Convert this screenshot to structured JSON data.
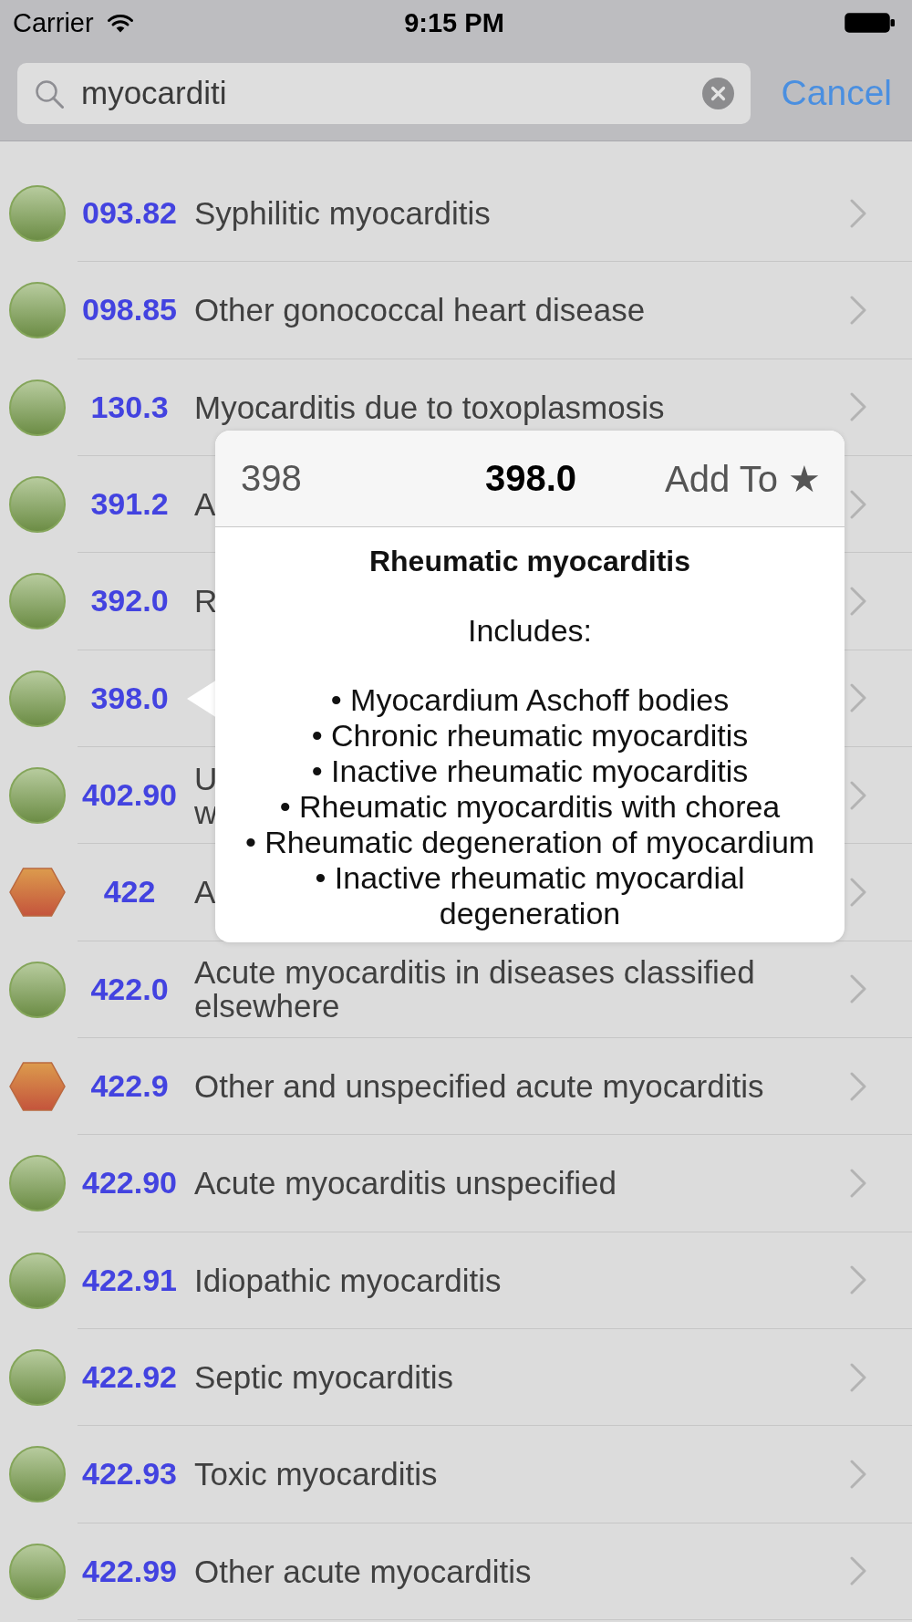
{
  "status_bar": {
    "carrier": "Carrier",
    "time": "9:15 PM"
  },
  "search": {
    "value": "myocarditi",
    "cancel": "Cancel"
  },
  "results": [
    {
      "code": "093.82",
      "kind": "circle",
      "selected": false,
      "lines": [
        "Syphilitic myocarditis"
      ]
    },
    {
      "code": "098.85",
      "kind": "circle",
      "selected": false,
      "lines": [
        "Other gonococcal heart disease"
      ]
    },
    {
      "code": "130.3",
      "kind": "circle",
      "selected": false,
      "lines": [
        "Myocarditis due to toxoplasmosis"
      ]
    },
    {
      "code": "391.2",
      "kind": "circle",
      "selected": false,
      "lines": [
        "A"
      ]
    },
    {
      "code": "392.0",
      "kind": "circle",
      "selected": false,
      "lines": [
        "R"
      ]
    },
    {
      "code": "398.0",
      "kind": "circle",
      "selected": true
    },
    {
      "code": "402.90",
      "kind": "circle",
      "selected": false,
      "lines": [
        "U",
        "w"
      ]
    },
    {
      "code": "422",
      "kind": "hexagon",
      "selected": false,
      "lines": [
        "A"
      ]
    },
    {
      "code": "422.0",
      "kind": "circle",
      "selected": false,
      "lines": [
        "Acute myocarditis in diseases classified",
        "elsewhere"
      ]
    },
    {
      "code": "422.9",
      "kind": "hexagon",
      "selected": false,
      "lines": [
        "Other and unspecified acute myocarditis"
      ]
    },
    {
      "code": "422.90",
      "kind": "circle",
      "selected": false,
      "lines": [
        "Acute myocarditis unspecified"
      ]
    },
    {
      "code": "422.91",
      "kind": "circle",
      "selected": false,
      "lines": [
        "Idiopathic myocarditis"
      ]
    },
    {
      "code": "422.92",
      "kind": "circle",
      "selected": false,
      "lines": [
        "Septic myocarditis"
      ]
    },
    {
      "code": "422.93",
      "kind": "circle",
      "selected": false,
      "lines": [
        "Toxic myocarditis"
      ]
    },
    {
      "code": "422.99",
      "kind": "circle",
      "selected": false,
      "lines": [
        "Other acute myocarditis"
      ]
    }
  ],
  "popover": {
    "parent_code": "398",
    "code": "398.0",
    "action": "Add To ★",
    "heading": "Rheumatic myocarditis",
    "includes_label": "Includes:",
    "items": [
      "• Myocardium Aschoff bodies",
      "• Chronic rheumatic myocarditis",
      "• Inactive rheumatic myocarditis",
      "• Rheumatic myocarditis with chorea",
      "• Rheumatic degeneration of myocardium",
      "• Inactive rheumatic myocardial degeneration"
    ]
  }
}
